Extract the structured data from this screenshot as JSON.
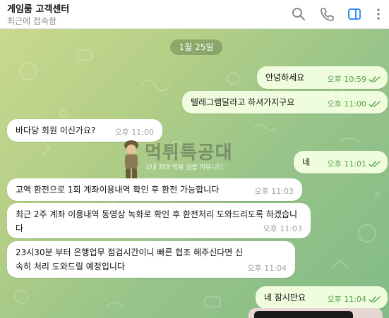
{
  "header": {
    "title": "게임룸 고객센터",
    "status": "최근에 접속함",
    "icons": [
      "search-icon",
      "phone-icon",
      "sidebar-icon",
      "more-icon"
    ]
  },
  "chat": {
    "date": "1월 25일",
    "messages": [
      {
        "dir": "out",
        "text": "안녕하세요",
        "time": "오후 10:59"
      },
      {
        "dir": "out",
        "text": "텔레그램달라고 하셔가지구요",
        "time": "오후 11:00"
      },
      {
        "dir": "in",
        "text": "바다당 회원 이신가요?",
        "time": "오후 11:00"
      },
      {
        "dir": "out",
        "text": "네",
        "time": "오후 11:01"
      },
      {
        "dir": "in",
        "text": "고액 환전으로 1회 계좌이용내역 확인 후 환전 가능합니다",
        "time": "오후 11:03"
      },
      {
        "dir": "in",
        "text": "최근 2주 계좌 이용내역 동영상 녹화로 확인 후 환전처리 도와드리도록 하겠습니다",
        "time": "오후 11:03"
      },
      {
        "dir": "in",
        "text": "23시30분 부터 은행업무 점검시간이니 빠른 협조 해주신다면 신속히 처리 도와드릴 예정입니다",
        "time": "오후 11:04"
      },
      {
        "dir": "out",
        "text": "네 잠시만요",
        "time": "오후 11:04"
      }
    ]
  },
  "watermark": {
    "title": "먹튀특공대",
    "subtitle": "국내 최대 먹튀 검증 커뮤니티"
  },
  "colors": {
    "accent": "#3390ec",
    "outgoing_bubble": "#effdde",
    "incoming_bubble": "#ffffff",
    "check": "#5aa34a"
  }
}
